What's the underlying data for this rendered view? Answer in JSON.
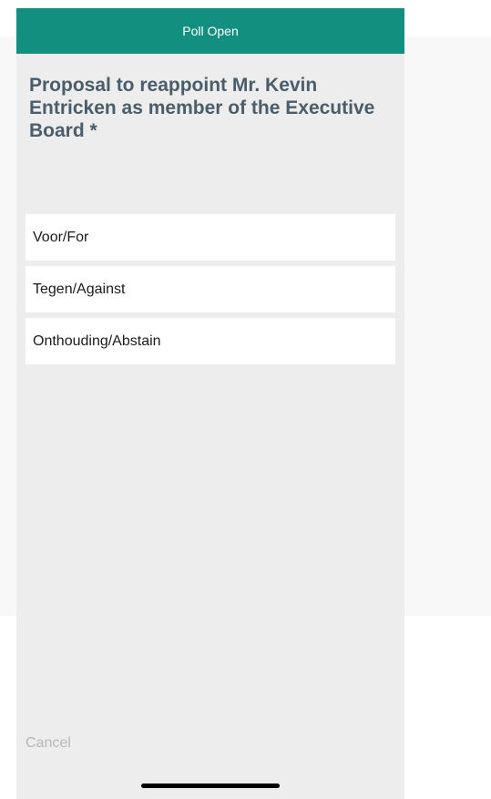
{
  "header": {
    "title": "Poll Open"
  },
  "poll": {
    "question": "Proposal to reappoint Mr. Kevin Entricken as member of the Executive Board *",
    "options": [
      {
        "label": "Voor/For"
      },
      {
        "label": "Tegen/Against"
      },
      {
        "label": "Onthouding/Abstain"
      }
    ]
  },
  "footer": {
    "cancel_label": "Cancel"
  },
  "colors": {
    "header_bg": "#138f80",
    "question_text": "#4a5d6a",
    "cancel_text": "#b7b7b7"
  }
}
